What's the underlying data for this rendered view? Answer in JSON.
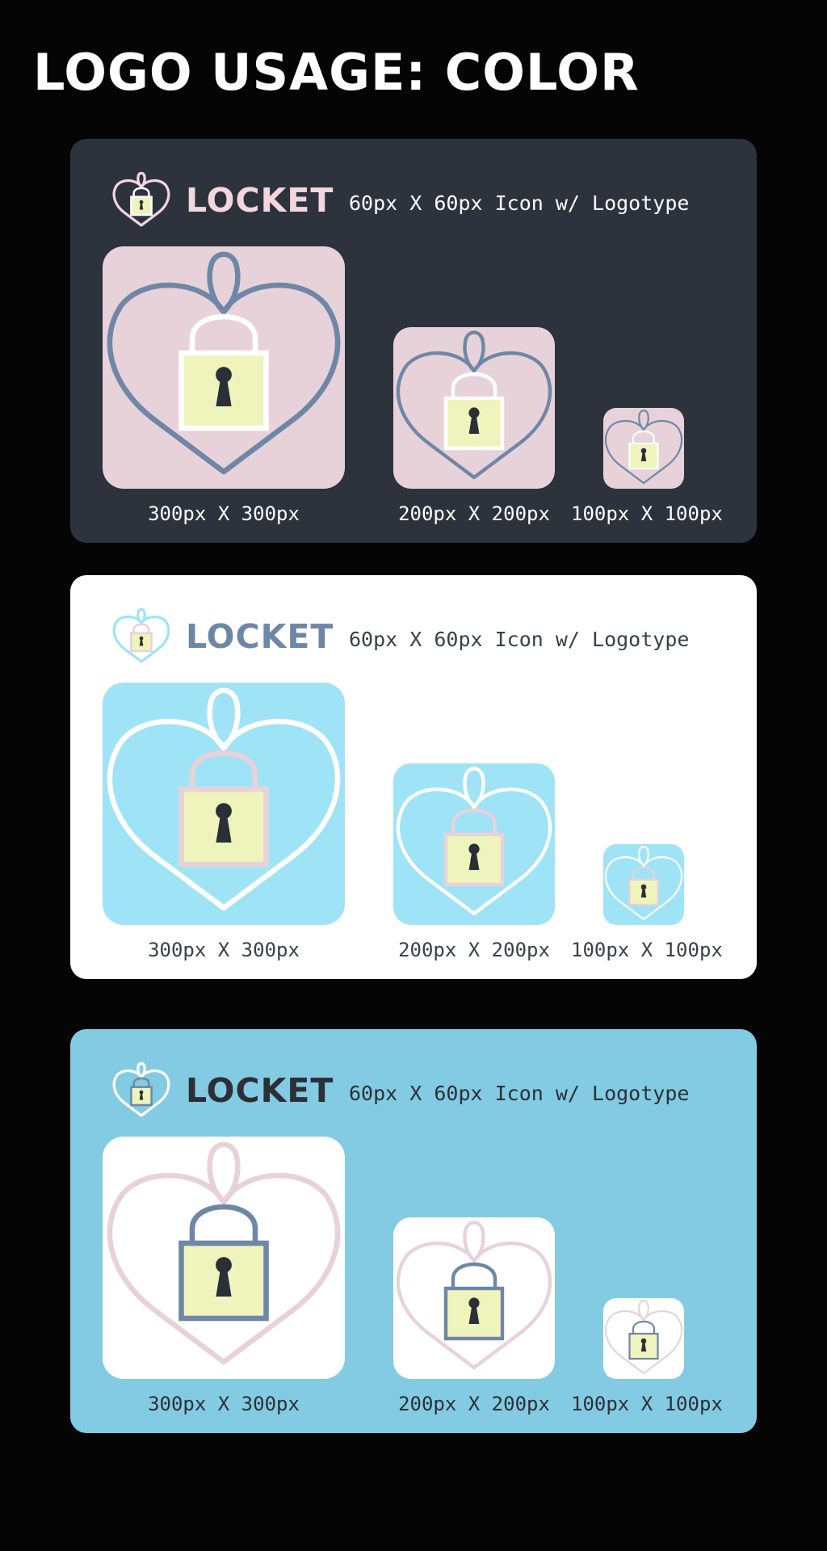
{
  "page": {
    "title": "LOGO USAGE: COLOR"
  },
  "panels": [
    {
      "id": "dark",
      "wordmark": "LOCKET",
      "caption": "60px X 60px Icon w/ Logotype",
      "sizes": [
        "300px X 300px",
        "200px X 200px",
        "100px X 100px"
      ],
      "colors": {
        "panel": "#2d333c",
        "text": "#ffffff",
        "wordmark": "#f3d6de",
        "tile": "#e8d2d9",
        "heart": "#6f87a6",
        "shackle": "#ffffff",
        "lock_body": "#eef4bc",
        "lock_border": "#ffffff",
        "keyhole": "#2b2f36",
        "header_heart": "#f3d6de",
        "header_shackle": "#ffffff",
        "header_body": "#eef4bc",
        "header_border": "#ffffff"
      }
    },
    {
      "id": "white",
      "wordmark": "LOCKET",
      "caption": "60px X 60px Icon w/ Logotype",
      "sizes": [
        "300px X 300px",
        "200px X 200px",
        "100px X 100px"
      ],
      "colors": {
        "panel": "#ffffff",
        "text": "#3a4048",
        "wordmark": "#6f87a6",
        "tile": "#9fe3f6",
        "heart": "#ffffff",
        "shackle": "#e8d2d9",
        "lock_body": "#eef4bc",
        "lock_border": "#e8d2d9",
        "keyhole": "#2b2f36",
        "header_heart": "#9fe3f6",
        "header_shackle": "#e8d2d9",
        "header_body": "#eef4bc",
        "header_border": "#e8d2d9"
      }
    },
    {
      "id": "blue",
      "wordmark": "LOCKET",
      "caption": "60px X 60px Icon w/ Logotype",
      "sizes": [
        "300px X 300px",
        "200px X 200px",
        "100px X 100px"
      ],
      "colors": {
        "panel": "#83cbe2",
        "text": "#2b2f36",
        "wordmark": "#2b2f36",
        "tile": "#ffffff",
        "heart": "#e8d2d9",
        "shackle": "#6f87a6",
        "lock_body": "#eef4bc",
        "lock_border": "#6f87a6",
        "keyhole": "#2b2f36",
        "header_heart": "#ffffff",
        "header_shackle": "#6f87a6",
        "header_body": "#eef4bc",
        "header_border": "#6f87a6"
      }
    }
  ]
}
